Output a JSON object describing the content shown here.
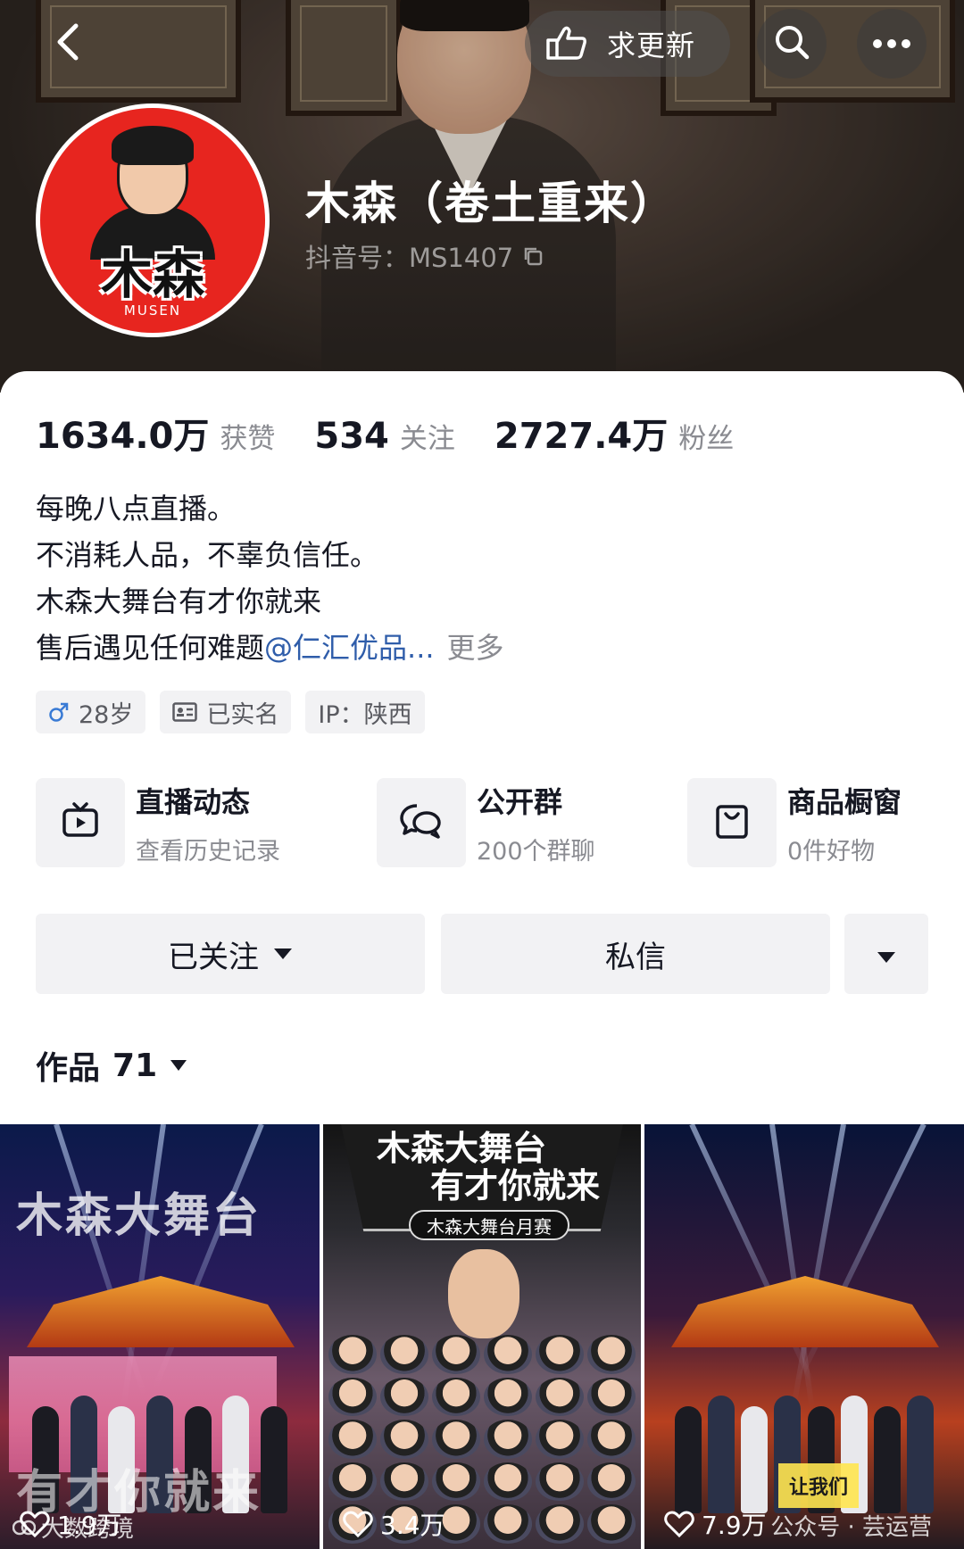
{
  "header": {
    "update_label": "求更新",
    "name": "木森（卷土重来）",
    "handle": "抖音号：MS1407",
    "avatar_brand": "木森",
    "avatar_brand_sub": "MUSEN"
  },
  "stats": [
    {
      "num": "1634.0万",
      "label": "获赞"
    },
    {
      "num": "534",
      "label": "关注"
    },
    {
      "num": "2727.4万",
      "label": "粉丝"
    }
  ],
  "bio": {
    "line1": "每晚八点直播。",
    "line2": "不消耗人品，不辜负信任。",
    "line3": "木森大舞台有才你就来",
    "line4_prefix": "售后遇见任何难题",
    "line4_mention": "@仁汇优品...",
    "more": "更多"
  },
  "tags": [
    {
      "icon": "male-icon",
      "label": "28岁"
    },
    {
      "icon": "id-card-icon",
      "label": "已实名"
    },
    {
      "icon": "",
      "label": "IP：陕西"
    }
  ],
  "features": [
    {
      "icon": "live-tv-icon",
      "title": "直播动态",
      "subtitle": "查看历史记录"
    },
    {
      "icon": "group-chat-icon",
      "title": "公开群",
      "subtitle": "200个群聊"
    },
    {
      "icon": "shopping-bag-icon",
      "title": "商品橱窗",
      "subtitle": "0件好物"
    }
  ],
  "actions": {
    "follow": "已关注",
    "message": "私信"
  },
  "works": {
    "label": "作品",
    "count": "71"
  },
  "videos": [
    {
      "overlay_top": "木森大舞台",
      "overlay_bottom": "有才你就来",
      "views": "1.9万"
    },
    {
      "title1": "木森大舞台",
      "title2": "有才你就来",
      "subtitle": "木森大舞台月赛",
      "views": "3.4万"
    },
    {
      "caption": "让我们",
      "views": "7.9万"
    }
  ],
  "watermarks": {
    "left": "大数跨境",
    "right": "公众号 · 芸运营"
  },
  "colors": {
    "mention": "#2f5daa",
    "muted": "#8a8b91",
    "chip_bg": "#f2f2f4",
    "text": "#161823"
  }
}
